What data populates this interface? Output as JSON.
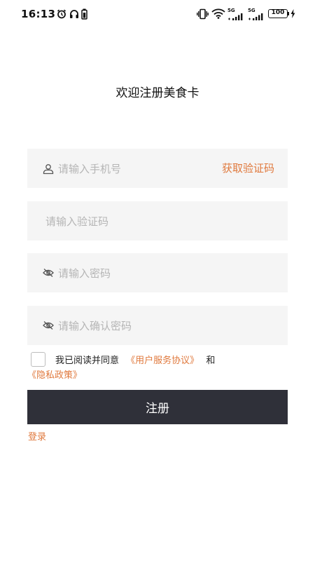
{
  "status_bar": {
    "time": "16:13",
    "signal_1_label": "5G",
    "signal_2_label": "5G",
    "battery": "100"
  },
  "page": {
    "title": "欢迎注册美食卡"
  },
  "form": {
    "phone_placeholder": "请输入手机号",
    "get_code_label": "获取验证码",
    "code_placeholder": "请输入验证码",
    "password_placeholder": "请输入密码",
    "confirm_placeholder": "请输入确认密码"
  },
  "agreement": {
    "prefix": "我已阅读并同意",
    "user_agreement": "《用户服务协议》",
    "conjunction": "和",
    "privacy_policy": "《隐私政策》",
    "checked": false
  },
  "actions": {
    "register_label": "注册",
    "login_label": "登录"
  },
  "colors": {
    "accent": "#e0793d",
    "button_bg": "#2f3039",
    "field_bg": "#f5f5f5"
  }
}
